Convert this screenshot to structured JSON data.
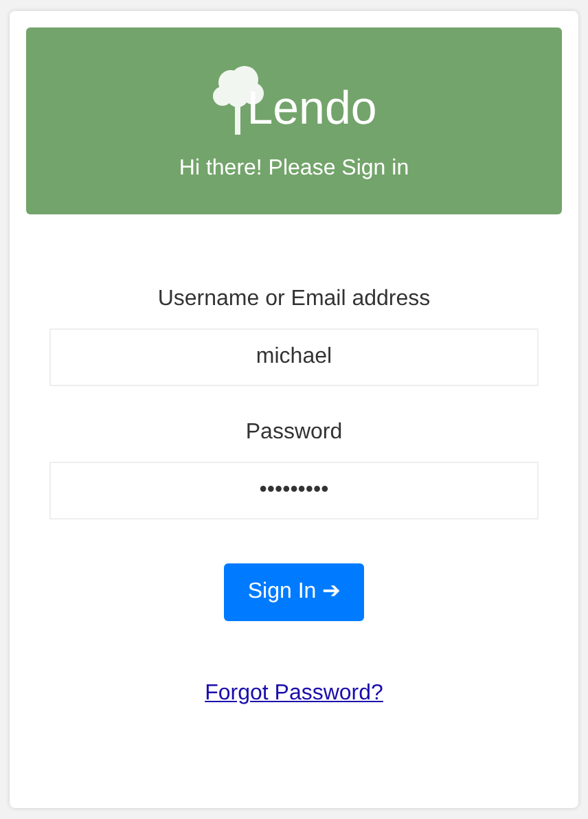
{
  "header": {
    "logo_text": "Lendo",
    "greeting": "Hi there! Please Sign in"
  },
  "fields": [
    {
      "label": "Username or Email address",
      "value": "michael"
    },
    {
      "label": "Password",
      "value": "•••••••••"
    }
  ],
  "submit": {
    "label": "Sign In ➔"
  },
  "forgot_link": "Forgot Password?"
}
